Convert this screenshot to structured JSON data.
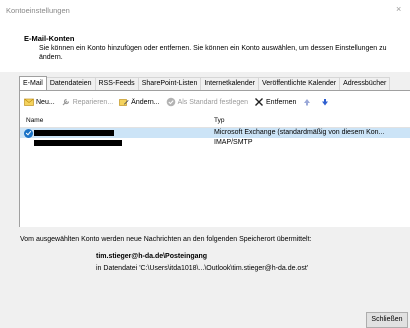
{
  "window": {
    "title": "Kontoeinstellungen",
    "close_glyph": "×"
  },
  "header": {
    "title": "E-Mail-Konten",
    "description": "Sie können ein Konto hinzufügen oder entfernen. Sie können ein Konto auswählen, um dessen Einstellungen zu ändern."
  },
  "tabs": [
    {
      "label": "E-Mail",
      "active": true
    },
    {
      "label": "Datendateien"
    },
    {
      "label": "RSS-Feeds"
    },
    {
      "label": "SharePoint-Listen"
    },
    {
      "label": "Internetkalender"
    },
    {
      "label": "Veröffentlichte Kalender"
    },
    {
      "label": "Adressbücher"
    }
  ],
  "toolbar": {
    "new": {
      "label": "Neu...",
      "icon": "new-mail-icon"
    },
    "repair": {
      "label": "Reparieren...",
      "icon": "repair-icon",
      "disabled": true
    },
    "change": {
      "label": "Ändern...",
      "icon": "change-icon"
    },
    "default": {
      "label": "Als Standard festlegen",
      "icon": "check-icon",
      "disabled": true
    },
    "remove": {
      "label": "Entfernen",
      "icon": "remove-icon"
    },
    "up": {
      "icon": "arrow-up-icon"
    },
    "down": {
      "icon": "arrow-down-icon"
    }
  },
  "accounts": {
    "columns": {
      "name": "Name",
      "type": "Typ"
    },
    "rows": [
      {
        "name_redacted": true,
        "type": "Microsoft Exchange (standardmäßig von diesem Kon...",
        "selected": true,
        "default": true
      },
      {
        "name_redacted": true,
        "type": "IMAP/SMTP",
        "selected": false,
        "default": false
      }
    ]
  },
  "storage": {
    "intro": "Vom ausgewählten Konto werden neue Nachrichten an den folgenden Speicherort übermittelt:",
    "location": "tim.stieger@h-da.de\\Posteingang",
    "path": "in Datendatei 'C:\\Users\\itda1018\\...\\Outlook\\tim.stieger@h-da.de.ost'"
  },
  "buttons": {
    "close": "Schließen"
  },
  "colors": {
    "selection": "#cce4f7",
    "accent": "#1a73c7",
    "remove": "#202020"
  }
}
